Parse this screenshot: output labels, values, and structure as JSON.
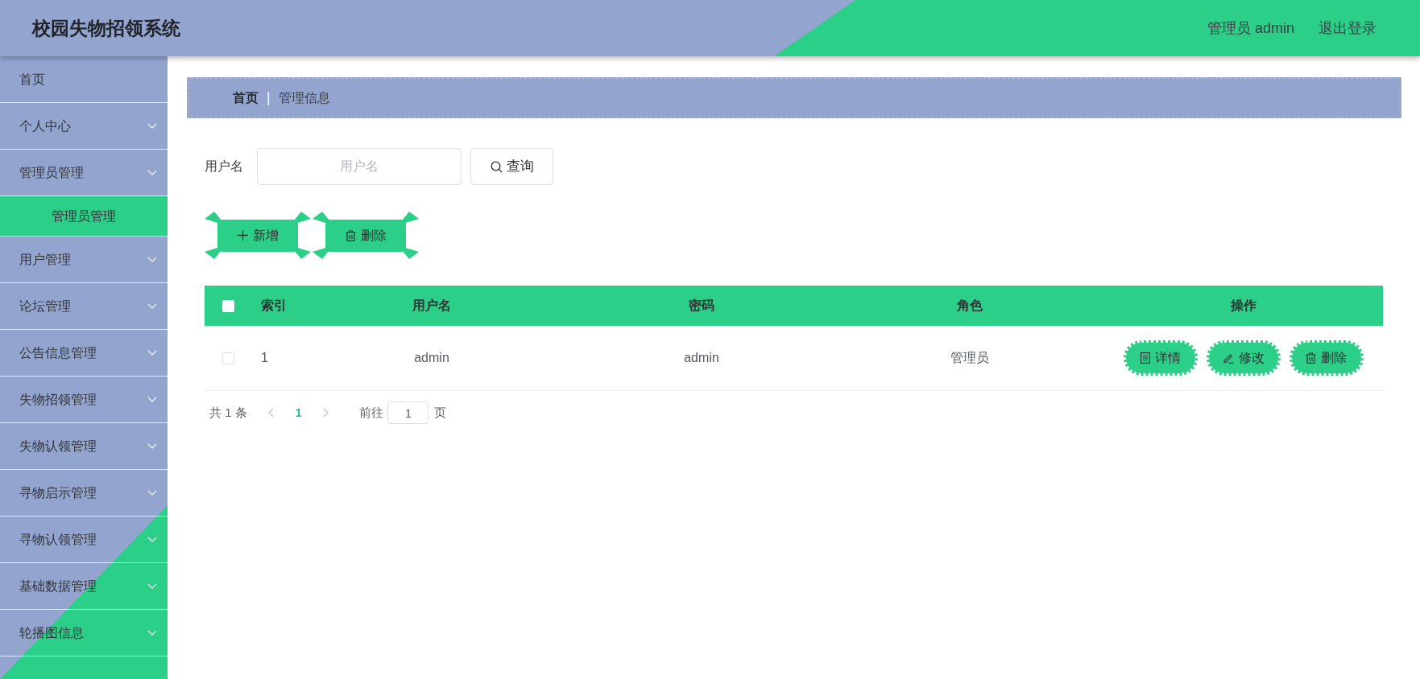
{
  "header": {
    "title": "校园失物招领系统",
    "user": "管理员 admin",
    "logout": "退出登录"
  },
  "sidebar": {
    "items": [
      {
        "label": "首页",
        "kind": "link",
        "selected": false
      },
      {
        "label": "个人中心",
        "kind": "submenu",
        "selected": false
      },
      {
        "label": "管理员管理",
        "kind": "submenu",
        "selected": false,
        "children": [
          {
            "label": "管理员管理",
            "selected": true
          }
        ]
      },
      {
        "label": "用户管理",
        "kind": "submenu",
        "selected": false
      },
      {
        "label": "论坛管理",
        "kind": "submenu",
        "selected": false
      },
      {
        "label": "公告信息管理",
        "kind": "submenu",
        "selected": false
      },
      {
        "label": "失物招领管理",
        "kind": "submenu",
        "selected": false
      },
      {
        "label": "失物认领管理",
        "kind": "submenu",
        "selected": false
      },
      {
        "label": "寻物启示管理",
        "kind": "submenu",
        "selected": false
      },
      {
        "label": "寻物认领管理",
        "kind": "submenu",
        "selected": false
      },
      {
        "label": "基础数据管理",
        "kind": "submenu",
        "selected": false
      },
      {
        "label": "轮播图信息",
        "kind": "submenu",
        "selected": false
      }
    ]
  },
  "breadcrumb": {
    "separator": "|",
    "items": [
      {
        "label": "首页",
        "current": false
      },
      {
        "label": "管理信息",
        "current": true
      }
    ]
  },
  "search": {
    "label": "用户名",
    "placeholder": "用户名",
    "button": "查询"
  },
  "toolbar": [
    {
      "label": "新增",
      "kind": "add"
    },
    {
      "label": "删除",
      "kind": "delete"
    }
  ],
  "table": {
    "select_all": {
      "checked": false
    },
    "columns": [
      "索引",
      "用户名",
      "密码",
      "角色",
      "操作"
    ],
    "rows": [
      {
        "checked": false,
        "cells": [
          "1",
          "admin",
          "admin",
          "管理员"
        ],
        "actions": [
          {
            "label": "详情",
            "kind": "detail"
          },
          {
            "label": "修改",
            "kind": "edit"
          },
          {
            "label": "删除",
            "kind": "delete"
          }
        ]
      }
    ]
  },
  "pagination": {
    "total": "共 1 条",
    "pages": [
      {
        "label": "1",
        "selected": true
      }
    ],
    "goto_label": "前往",
    "goto_value": "1",
    "page_suffix": "页"
  }
}
